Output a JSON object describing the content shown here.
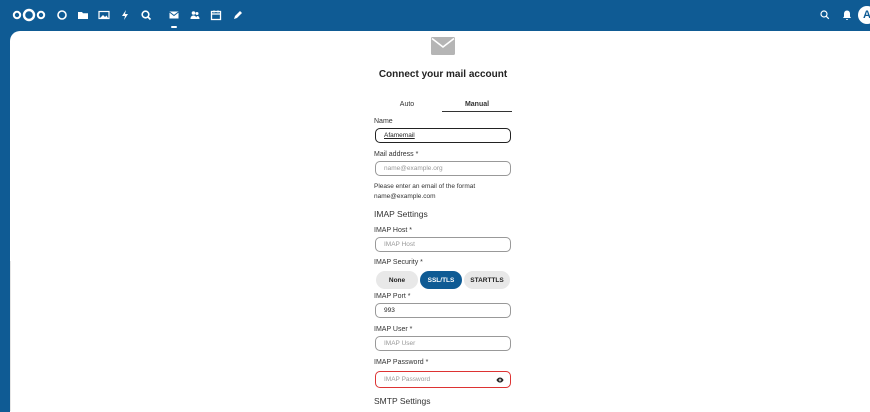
{
  "topbar": {
    "nav": [
      {
        "name": "dashboard-icon"
      },
      {
        "name": "files-icon"
      },
      {
        "name": "photos-icon"
      },
      {
        "name": "activity-icon"
      },
      {
        "name": "search-app-icon"
      },
      {
        "name": "mail-icon"
      },
      {
        "name": "contacts-icon"
      },
      {
        "name": "calendar-icon"
      },
      {
        "name": "notes-icon"
      }
    ],
    "right": [
      {
        "name": "search-icon"
      },
      {
        "name": "notifications-icon"
      },
      {
        "name": "contacts-menu-icon"
      }
    ],
    "avatar_initial": "A",
    "bg_color": "#0f5b94"
  },
  "form": {
    "title": "Connect your mail account",
    "tabs": [
      {
        "label": "Auto",
        "active": false
      },
      {
        "label": "Manual",
        "active": true
      }
    ],
    "name": {
      "label": "Name",
      "value": "Afamemail"
    },
    "mail_address": {
      "label": "Mail address *",
      "placeholder": "name@example.org"
    },
    "mail_hint": "Please enter an email of the format name@example.com",
    "imap_section": "IMAP Settings",
    "imap_host": {
      "label": "IMAP Host *",
      "placeholder": "IMAP Host"
    },
    "imap_security": {
      "label": "IMAP Security *",
      "options": [
        "None",
        "SSL/TLS",
        "STARTTLS"
      ],
      "selected": "SSL/TLS"
    },
    "imap_port": {
      "label": "IMAP Port *",
      "value": "993"
    },
    "imap_user": {
      "label": "IMAP User *",
      "placeholder": "IMAP User"
    },
    "imap_password": {
      "label": "IMAP Password *",
      "placeholder": "IMAP Password"
    },
    "smtp_section": "SMTP Settings"
  }
}
